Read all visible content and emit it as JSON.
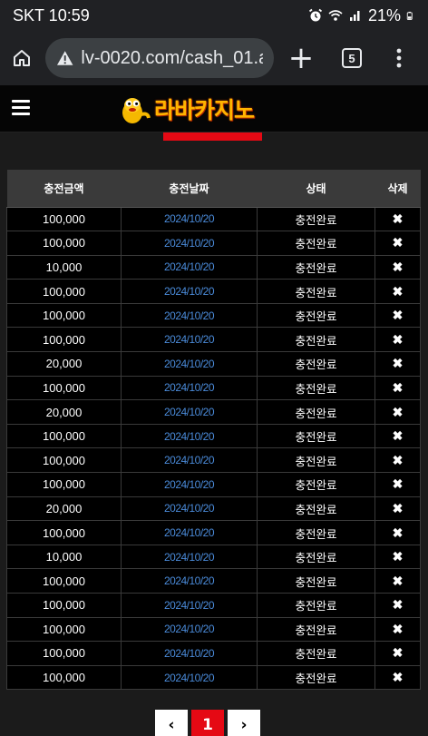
{
  "status_bar": {
    "carrier_time": "SKT 10:59",
    "battery": "21%",
    "icons": [
      "alarm-icon",
      "wifi-icon",
      "signal-icon",
      "battery-icon"
    ]
  },
  "browser": {
    "url": "lv-0020.com/cash_01.a",
    "tab_count": "5",
    "new_tab_label": "+",
    "icons": [
      "home-icon",
      "warning-icon",
      "plus-icon",
      "tabs-icon",
      "overflow-menu-icon"
    ]
  },
  "site": {
    "logo_text": "라바카지노"
  },
  "table": {
    "headers": {
      "amount": "충전금액",
      "date": "충전날짜",
      "status": "상태",
      "delete": "삭제"
    },
    "rows": [
      {
        "amount": "100,000",
        "date": "2024/10/20",
        "status": "충전완료",
        "del": "✖"
      },
      {
        "amount": "100,000",
        "date": "2024/10/20",
        "status": "충전완료",
        "del": "✖"
      },
      {
        "amount": "10,000",
        "date": "2024/10/20",
        "status": "충전완료",
        "del": "✖"
      },
      {
        "amount": "100,000",
        "date": "2024/10/20",
        "status": "충전완료",
        "del": "✖"
      },
      {
        "amount": "100,000",
        "date": "2024/10/20",
        "status": "충전완료",
        "del": "✖"
      },
      {
        "amount": "100,000",
        "date": "2024/10/20",
        "status": "충전완료",
        "del": "✖"
      },
      {
        "amount": "20,000",
        "date": "2024/10/20",
        "status": "충전완료",
        "del": "✖"
      },
      {
        "amount": "100,000",
        "date": "2024/10/20",
        "status": "충전완료",
        "del": "✖"
      },
      {
        "amount": "20,000",
        "date": "2024/10/20",
        "status": "충전완료",
        "del": "✖"
      },
      {
        "amount": "100,000",
        "date": "2024/10/20",
        "status": "충전완료",
        "del": "✖"
      },
      {
        "amount": "100,000",
        "date": "2024/10/20",
        "status": "충전완료",
        "del": "✖"
      },
      {
        "amount": "100,000",
        "date": "2024/10/20",
        "status": "충전완료",
        "del": "✖"
      },
      {
        "amount": "20,000",
        "date": "2024/10/20",
        "status": "충전완료",
        "del": "✖"
      },
      {
        "amount": "100,000",
        "date": "2024/10/20",
        "status": "충전완료",
        "del": "✖"
      },
      {
        "amount": "10,000",
        "date": "2024/10/20",
        "status": "충전완료",
        "del": "✖"
      },
      {
        "amount": "100,000",
        "date": "2024/10/20",
        "status": "충전완료",
        "del": "✖"
      },
      {
        "amount": "100,000",
        "date": "2024/10/20",
        "status": "충전완료",
        "del": "✖"
      },
      {
        "amount": "100,000",
        "date": "2024/10/20",
        "status": "충전완료",
        "del": "✖"
      },
      {
        "amount": "100,000",
        "date": "2024/10/20",
        "status": "충전완료",
        "del": "✖"
      },
      {
        "amount": "100,000",
        "date": "2024/10/20",
        "status": "충전완료",
        "del": "✖"
      }
    ]
  },
  "pagination": {
    "prev": "‹",
    "current": "1",
    "next": "›"
  },
  "colors": {
    "accent_red": "#e50914",
    "date_blue": "#4a8ad8",
    "logo_orange": "#ffb400"
  }
}
